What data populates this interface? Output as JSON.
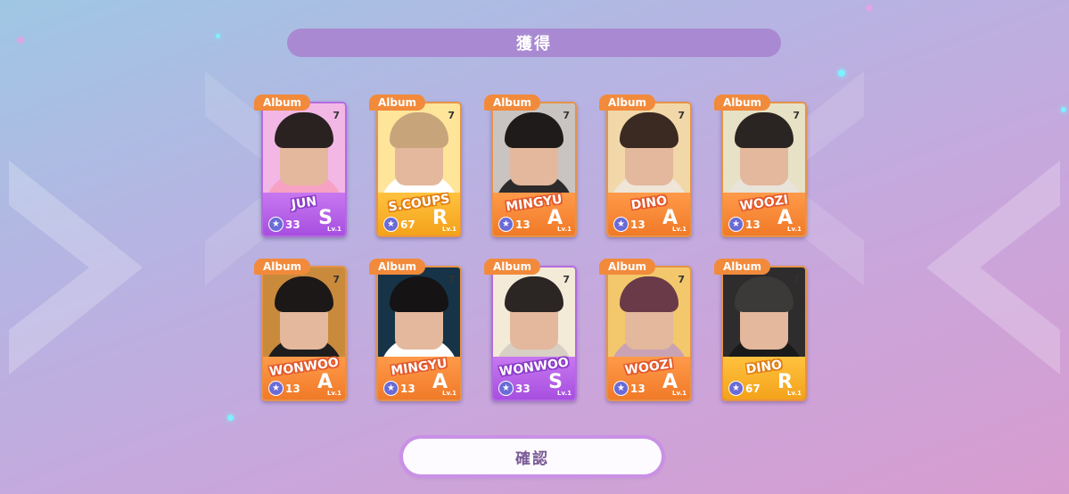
{
  "header": {
    "title": "獲得"
  },
  "cards": [
    {
      "tag": "Album",
      "name": "JUN",
      "rank": "S",
      "level": "Lv.1",
      "power": "33",
      "art_bg": "#f3b7e6",
      "torso": "#f7a1c4",
      "hair": "#2a2221",
      "logo": "7"
    },
    {
      "tag": "Album",
      "name": "S.COUPS",
      "rank": "R",
      "level": "Lv.1",
      "power": "67",
      "art_bg": "#ffe59a",
      "torso": "#ffffff",
      "hair": "#c7a47a",
      "logo": "7"
    },
    {
      "tag": "Album",
      "name": "MINGYU",
      "rank": "A",
      "level": "Lv.1",
      "power": "13",
      "art_bg": "#c9c4c1",
      "torso": "#2d2a2b",
      "hair": "#1f1b1b",
      "logo": "7"
    },
    {
      "tag": "Album",
      "name": "DINO",
      "rank": "A",
      "level": "Lv.1",
      "power": "13",
      "art_bg": "#f2d8a8",
      "torso": "#efe6d8",
      "hair": "#3a2a22",
      "logo": "7"
    },
    {
      "tag": "Album",
      "name": "WOOZI",
      "rank": "A",
      "level": "Lv.1",
      "power": "13",
      "art_bg": "#e7e1c5",
      "torso": "#e9e4da",
      "hair": "#2a2522",
      "logo": "7"
    },
    {
      "tag": "Album",
      "name": "WONWOO",
      "rank": "A",
      "level": "Lv.1",
      "power": "13",
      "art_bg": "#c98a3c",
      "torso": "#1f1d1e",
      "hair": "#1c1818",
      "logo": "7"
    },
    {
      "tag": "Album",
      "name": "MINGYU",
      "rank": "A",
      "level": "Lv.1",
      "power": "13",
      "art_bg": "#173347",
      "torso": "#ffffff",
      "hair": "#151314",
      "logo": "7"
    },
    {
      "tag": "Album",
      "name": "WONWOO",
      "rank": "S",
      "level": "Lv.1",
      "power": "33",
      "art_bg": "#f4ead8",
      "torso": "#d8cfc5",
      "hair": "#2b2524",
      "logo": "7"
    },
    {
      "tag": "Album",
      "name": "WOOZI",
      "rank": "A",
      "level": "Lv.1",
      "power": "13",
      "art_bg": "#f3c86c",
      "torso": "#c9a3b4",
      "hair": "#6a3a48",
      "logo": "7"
    },
    {
      "tag": "Album",
      "name": "DINO",
      "rank": "R",
      "level": "Lv.1",
      "power": "67",
      "art_bg": "#2e2c2d",
      "torso": "#1b1a1b",
      "hair": "#3b3a38",
      "logo": "7"
    }
  ],
  "footer": {
    "confirm_label": "確認"
  }
}
